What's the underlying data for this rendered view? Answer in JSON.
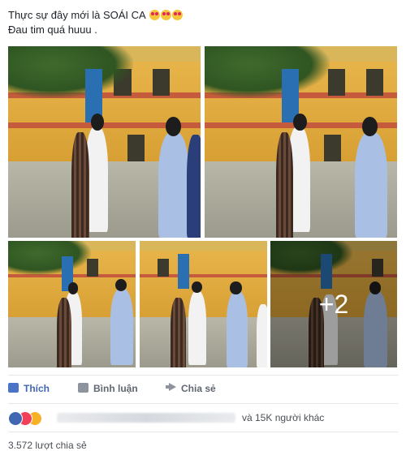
{
  "post": {
    "caption_line1": "Thực sự đây mới là SOÁI CA",
    "caption_line2": "Đau tim quá huuu .",
    "more_photos_label": "+2"
  },
  "actions": {
    "like_label": "Thích",
    "comment_label": "Bình luận",
    "share_label": "Chia sẻ"
  },
  "reactions": {
    "others_text": "và 15K người khác",
    "icons": [
      "like-reaction-icon",
      "love-reaction-icon",
      "wow-reaction-icon"
    ]
  },
  "shares": {
    "count_text": "3.572 lượt chia sẻ"
  },
  "colors": {
    "like_blue": "#4267b2",
    "love_red": "#f33e58",
    "wow_yellow": "#f7b125",
    "text_gray": "#606770"
  }
}
